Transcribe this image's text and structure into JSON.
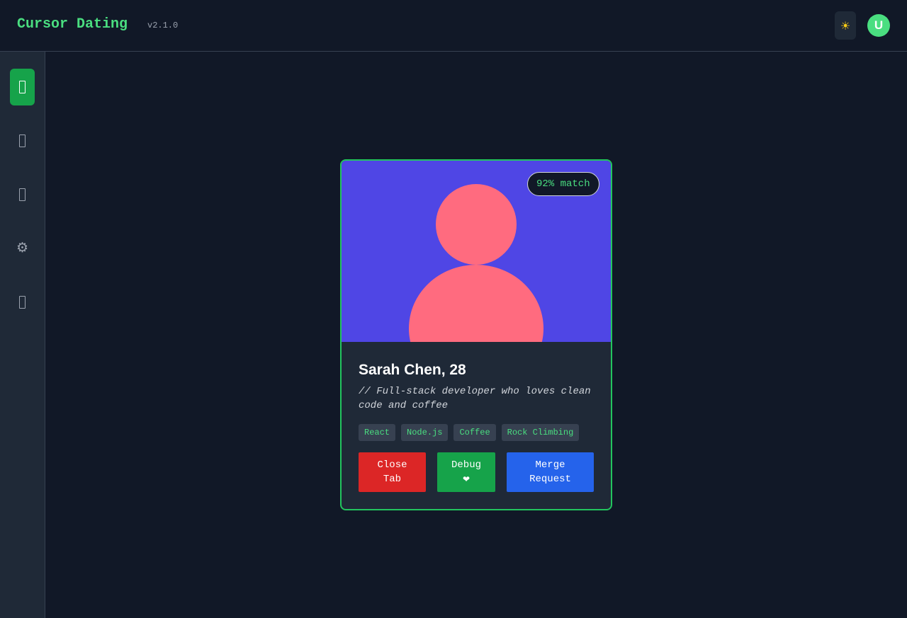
{
  "header": {
    "title": "Cursor Dating",
    "version": "v2.1.0",
    "theme_icon": "☀",
    "avatar_initial": "U"
  },
  "sidebar": {
    "items": [
      {
        "name": "sidebar-item-discover",
        "icon": "box-glyph",
        "active": true
      },
      {
        "name": "sidebar-item-matches",
        "icon": "box-glyph",
        "active": false
      },
      {
        "name": "sidebar-item-messages",
        "icon": "box-glyph",
        "active": false
      },
      {
        "name": "sidebar-item-settings",
        "icon": "⚙",
        "active": false
      },
      {
        "name": "sidebar-item-profile",
        "icon": "box-glyph",
        "active": false
      }
    ]
  },
  "profile": {
    "match": "92% match",
    "name": "Sarah Chen, 28",
    "bio": "// Full-stack developer who loves clean code and coffee",
    "tags": [
      "React",
      "Node.js",
      "Coffee",
      "Rock Climbing"
    ]
  },
  "actions": {
    "close_line1": "Close",
    "close_line2": "Tab",
    "debug_line1": "Debug",
    "debug_line2": "❤",
    "merge_line1": "Merge",
    "merge_line2": "Request"
  },
  "colors": {
    "accent": "#4ade80",
    "photo_bg": "#4f46e5",
    "avatar_silhouette": "#ff6b7f",
    "close": "#dc2626",
    "debug": "#16a34a",
    "merge": "#2563eb"
  }
}
